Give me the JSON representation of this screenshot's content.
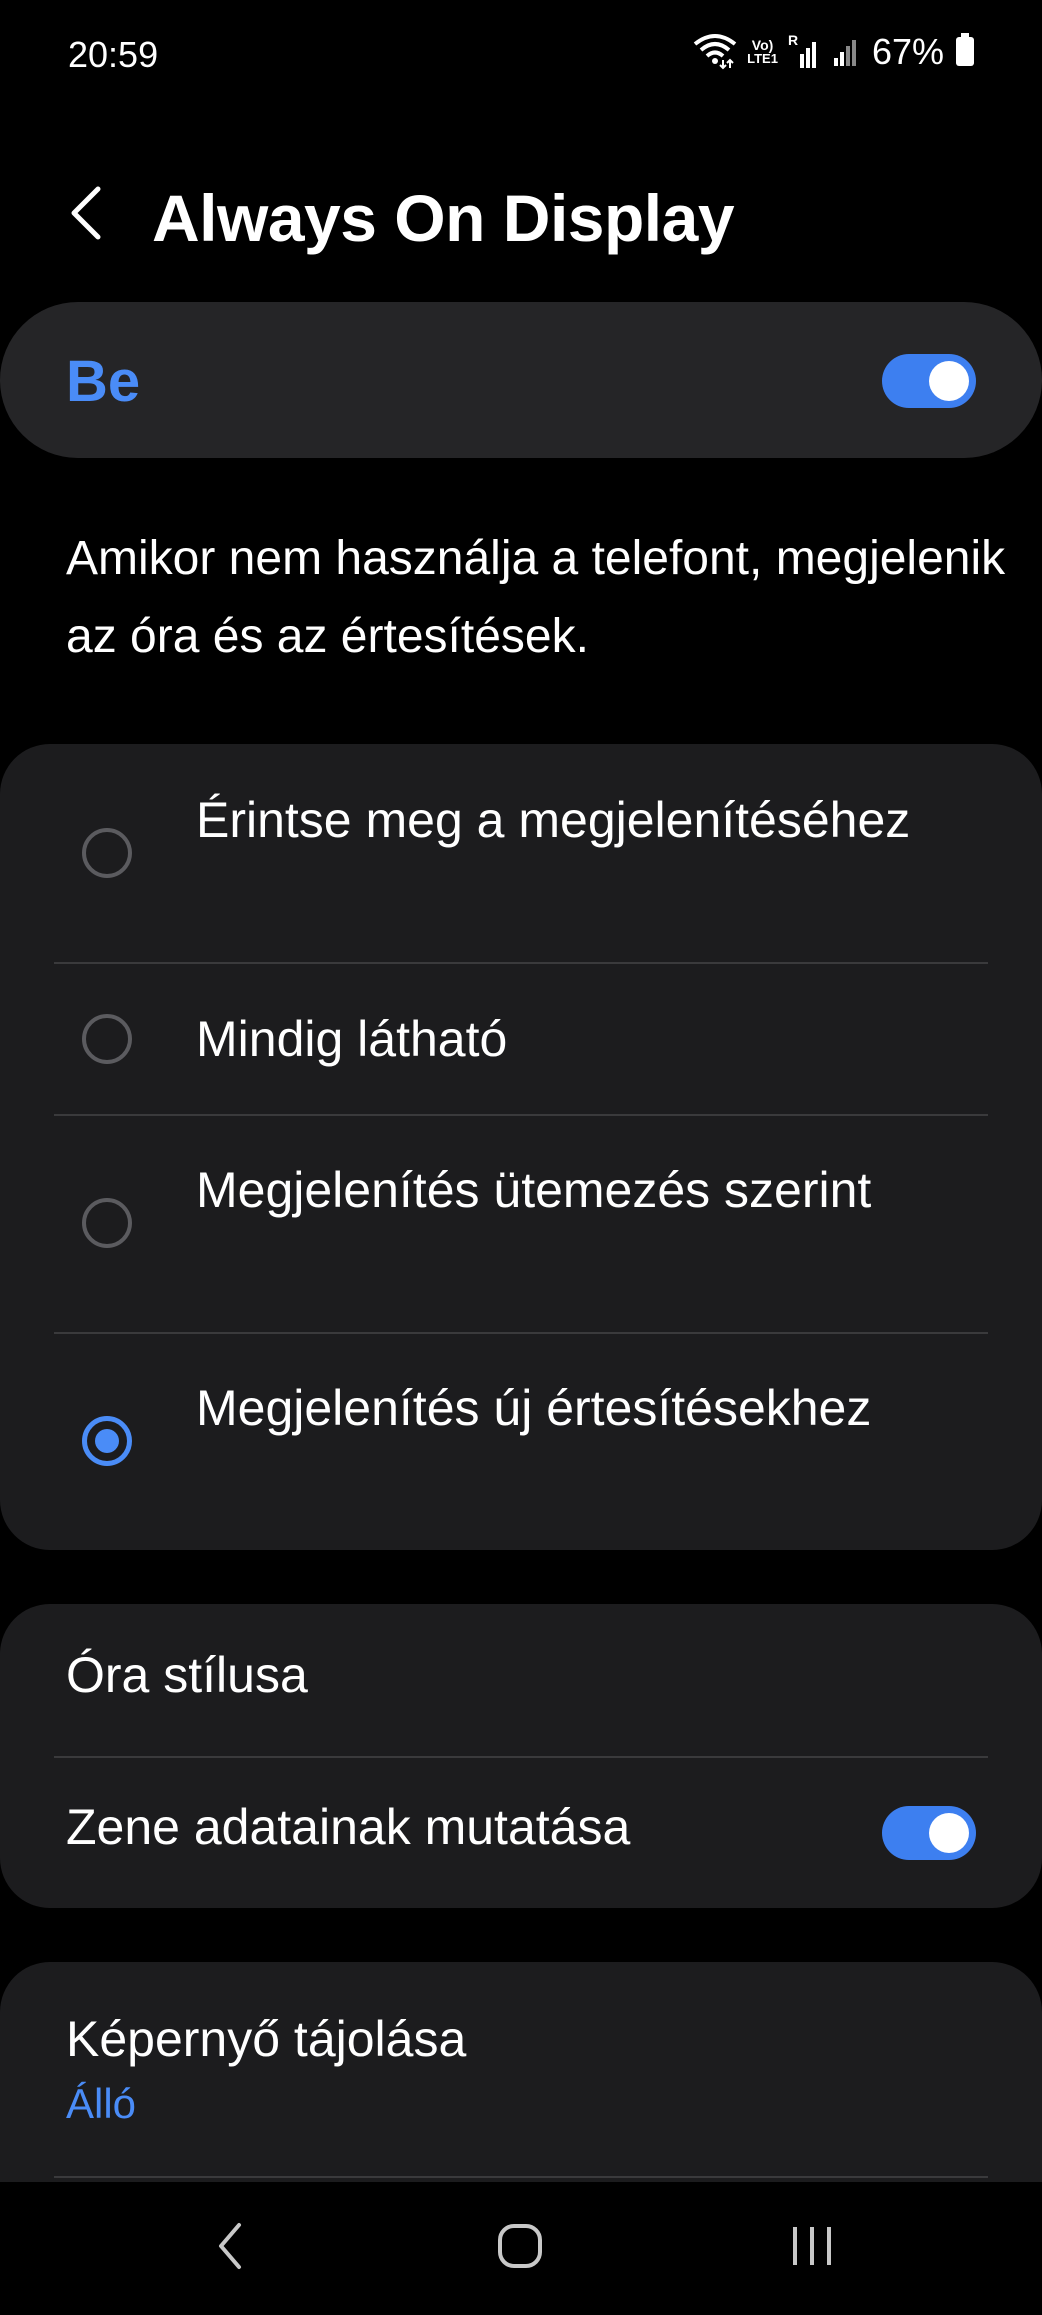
{
  "status_bar": {
    "time": "20:59",
    "battery_percent": "67%",
    "icons": [
      "wifi-icon",
      "volte-lte-icon",
      "signal-roaming-icon",
      "signal-icon",
      "battery-icon"
    ],
    "volte_text": "Vo)",
    "lte_text": "LTE1",
    "roaming_text": "R"
  },
  "header": {
    "title": "Always On Display",
    "back_icon": "chevron-left-icon"
  },
  "master_switch": {
    "label": "Be",
    "on": true
  },
  "description": "Amikor nem használja a telefont, megjelenik az óra és az értesítések.",
  "display_options": {
    "items": [
      {
        "label": "Érintse meg a megjelenítéséhez",
        "selected": false
      },
      {
        "label": "Mindig látható",
        "selected": false
      },
      {
        "label": "Megjelenítés ütemezés szerint",
        "selected": false
      },
      {
        "label": "Megjelenítés új értesítésekhez",
        "selected": true
      }
    ]
  },
  "settings": {
    "clock_style": "Óra stílusa",
    "music_info": "Zene adatainak mutatása",
    "music_info_on": true
  },
  "orientation": {
    "label": "Képernyő tájolása",
    "value": "Álló"
  },
  "nav_bar": {
    "back": "back-icon",
    "home": "home-icon",
    "recents": "recents-icon"
  },
  "colors": {
    "accent": "#4a8cf7",
    "toggle_on": "#3d7ff0",
    "card": "#1c1c1e",
    "master_card": "#252527",
    "background": "#000000"
  }
}
